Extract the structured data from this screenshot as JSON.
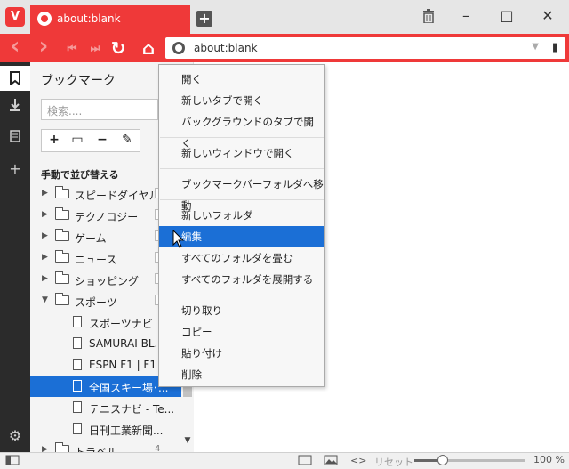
{
  "browser": {
    "logo": "V",
    "tab_title": "about:blank",
    "new_tab": "+"
  },
  "window": {
    "trash_icon": "trash-icon",
    "minimize": "–",
    "maximize": "□",
    "close": "✕"
  },
  "nav": {
    "back": "‹",
    "forward": "›",
    "rewind": "⏮",
    "fast_forward": "⏭",
    "reload": "↻",
    "home": "⌂",
    "address": "about:blank",
    "dropdown": "▼",
    "bookmark": "▮"
  },
  "sidebar": {
    "icons": [
      "bookmark-icon",
      "download-icon",
      "notes-icon",
      "add-panel-icon",
      "settings-icon"
    ]
  },
  "panel": {
    "title": "ブックマーク",
    "search_placeholder": "検索....",
    "tools": [
      "+",
      "▭",
      "−",
      "✎"
    ],
    "sort_label": "手動で並び替える",
    "items": [
      {
        "label": "スピードダイヤル",
        "type": "speeddial"
      },
      {
        "label": "テクノロジー",
        "type": "folder"
      },
      {
        "label": "ゲーム",
        "type": "folder"
      },
      {
        "label": "ニュース",
        "type": "folder"
      },
      {
        "label": "ショッピング",
        "type": "folder"
      },
      {
        "label": "スポーツ",
        "type": "folder-open"
      },
      {
        "label": "スポーツナビ",
        "type": "page"
      },
      {
        "label": "SAMURAI BL...",
        "type": "page"
      },
      {
        "label": "ESPN F1 | F1 ...",
        "type": "page"
      },
      {
        "label": "全国スキー場･...",
        "type": "page",
        "selected": true
      },
      {
        "label": "テニスナビ - Te...",
        "type": "page"
      },
      {
        "label": "日刊工業新聞...",
        "type": "page"
      },
      {
        "label": "トラベル",
        "type": "folder"
      }
    ],
    "travel_count": "4"
  },
  "context_menu": {
    "items": [
      "開く",
      "新しいタブで開く",
      "バックグラウンドのタブで開く",
      "新しいウィンドウで開く",
      "ブックマークバーフォルダへ移動",
      "新しいフォルダ",
      "編集",
      "すべてのフォルダを畳む",
      "すべてのフォルダを展開する",
      "切り取り",
      "コピー",
      "貼り付け",
      "削除"
    ],
    "highlighted": "編集"
  },
  "status": {
    "reset": "リセット",
    "zoom": "100 %",
    "zoom_fraction": 0.25
  },
  "colors": {
    "accent": "#ef3939",
    "selection": "#1b6fd6",
    "sidebar": "#2b2b2b"
  }
}
